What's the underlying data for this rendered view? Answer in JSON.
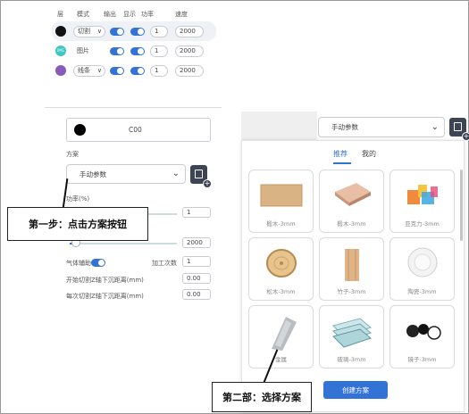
{
  "layers": {
    "headers": [
      "层",
      "模式",
      "输出",
      "显示",
      "功率",
      "速度"
    ],
    "rows": [
      {
        "color": "#111111",
        "mode": "切割",
        "power": "1",
        "speed": "2000",
        "chip": ""
      },
      {
        "color": "#3ec7c4",
        "mode": "图片",
        "power": "1",
        "speed": "2000",
        "chip": "IMG"
      },
      {
        "color": "#8a5ab8",
        "mode": "线条",
        "power": "1",
        "speed": "2000",
        "chip": ""
      }
    ]
  },
  "left": {
    "color_value": "C00",
    "scheme_label": "方案",
    "scheme_select": "手动参数",
    "power_label": "功率(%)",
    "power_value": "1",
    "speed_value": "2000",
    "air_assist_label": "气体辅助",
    "passes_label": "加工次数",
    "passes_value": "1",
    "start_depth_label": "开始切割Z轴下沉距离(mm)",
    "start_depth_value": "0.00",
    "each_depth_label": "每次切割Z轴下沉距离(mm)",
    "each_depth_value": "0.00"
  },
  "callouts": {
    "step1": "第一步：点击方案按钮",
    "step2": "第二部：选择方案"
  },
  "right": {
    "select": "手动参数",
    "tabs": [
      "推荐",
      "我的"
    ],
    "materials": [
      {
        "name": "椴木-3mm",
        "icon": "plywood-board-icon"
      },
      {
        "name": "椴木-3mm",
        "icon": "plywood-stack-icon"
      },
      {
        "name": "亚克力-3mm",
        "icon": "acrylic-sheets-icon"
      },
      {
        "name": "松木-3mm",
        "icon": "wood-slice-icon"
      },
      {
        "name": "竹子-3mm",
        "icon": "bamboo-board-icon"
      },
      {
        "name": "陶瓷-3mm",
        "icon": "ceramic-plate-icon"
      },
      {
        "name": "金属",
        "icon": "metal-sheet-icon"
      },
      {
        "name": "玻璃-3mm",
        "icon": "glass-panes-icon"
      },
      {
        "name": "镜子-3mm",
        "icon": "mirror-icon"
      }
    ],
    "create_button": "创建方案"
  },
  "colors": {
    "accent": "#3473d6",
    "save_button": "#3d4455"
  }
}
